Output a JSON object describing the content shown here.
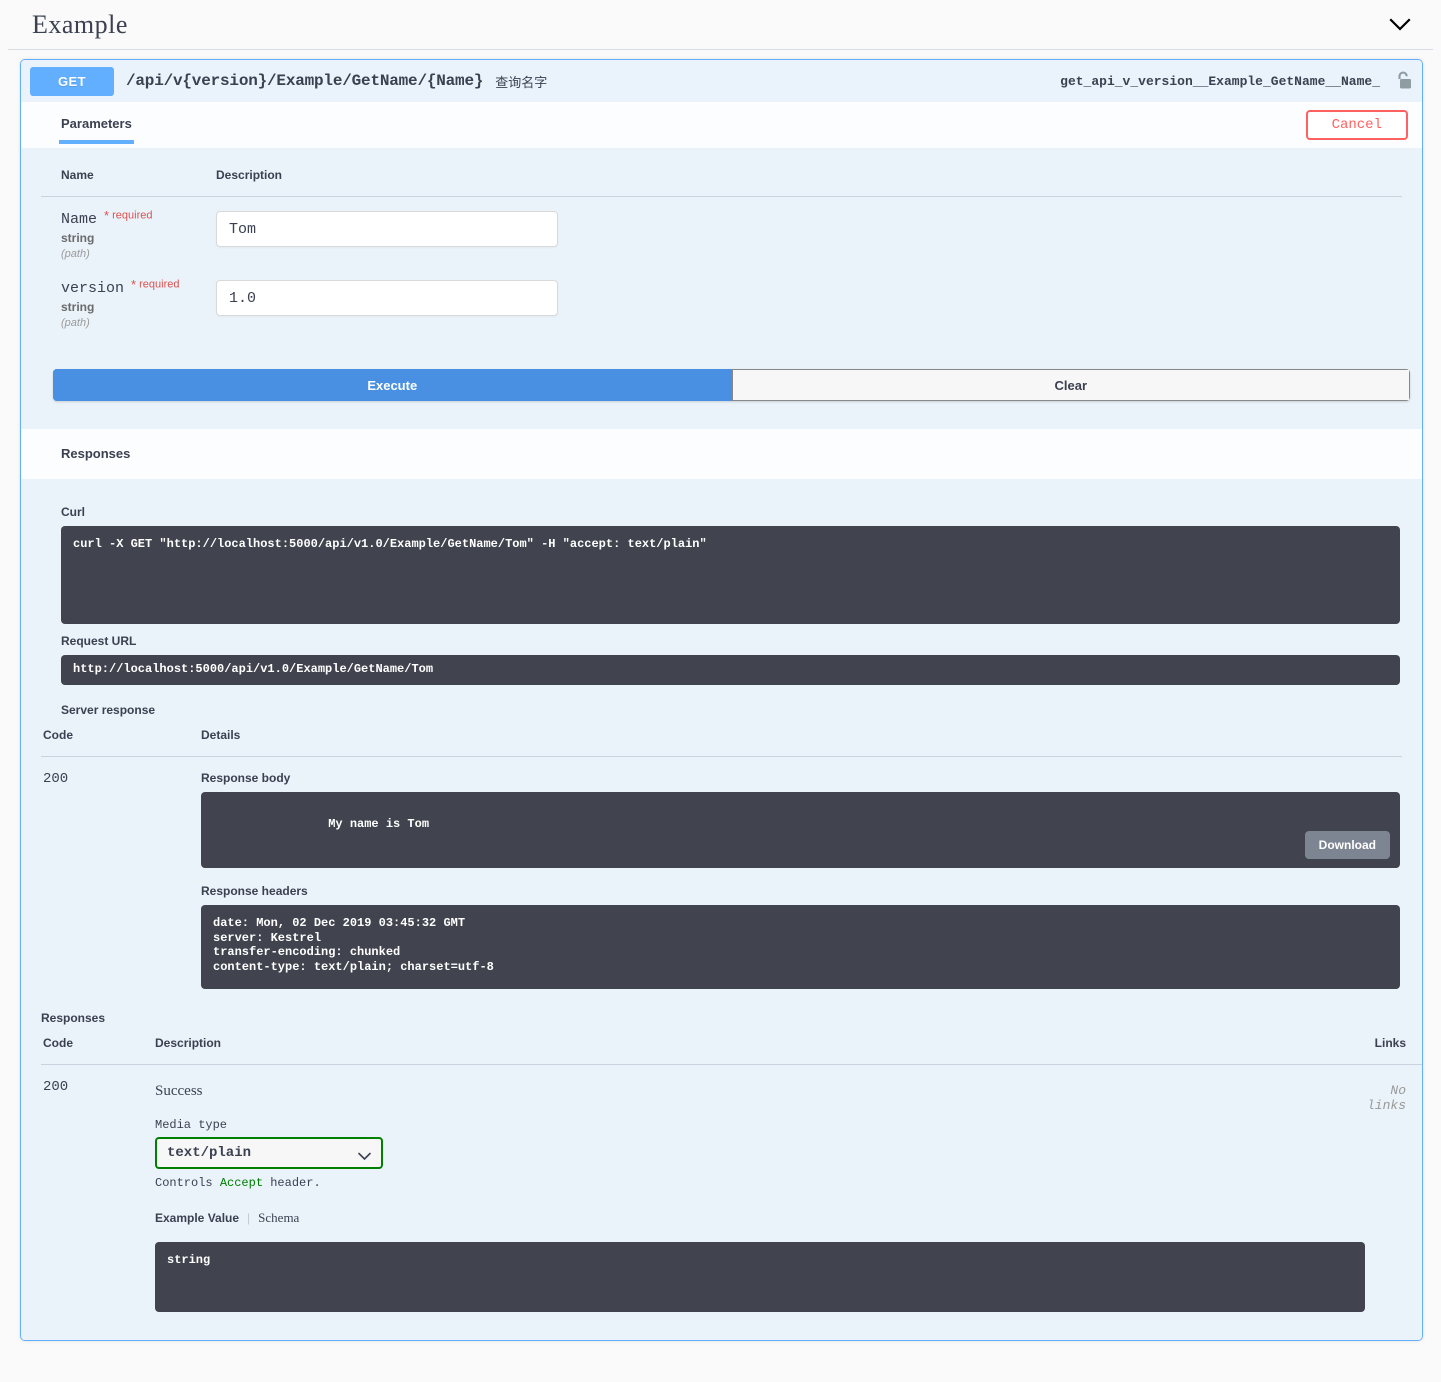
{
  "tag": {
    "title": "Example",
    "collapse_icon": "chevron-down-icon"
  },
  "operation": {
    "method": "GET",
    "path": "/api/v{version}/Example/GetName/{Name}",
    "description": "查询名字",
    "operation_id": "get_api_v_version__Example_GetName__Name_",
    "auth_icon": "unlocked-padlock-icon"
  },
  "tabs": {
    "parameters_label": "Parameters",
    "cancel_label": "Cancel"
  },
  "parameters": {
    "headers": {
      "name": "Name",
      "description": "Description"
    },
    "rows": [
      {
        "name": "Name",
        "required": "required",
        "type": "string",
        "in": "(path)",
        "value": "Tom"
      },
      {
        "name": "version",
        "required": "required",
        "type": "string",
        "in": "(path)",
        "value": "1.0"
      }
    ]
  },
  "actions": {
    "execute": "Execute",
    "clear": "Clear"
  },
  "responses_heading": "Responses",
  "live_response": {
    "curl_label": "Curl",
    "curl": "curl -X GET \"http://localhost:5000/api/v1.0/Example/GetName/Tom\" -H \"accept: text/plain\"",
    "request_url_label": "Request URL",
    "request_url": "http://localhost:5000/api/v1.0/Example/GetName/Tom",
    "server_response_label": "Server response",
    "headers": {
      "code": "Code",
      "details": "Details"
    },
    "code": "200",
    "response_body_label": "Response body",
    "response_body": "My name is Tom",
    "download_label": "Download",
    "response_headers_label": "Response headers",
    "response_headers": "date: Mon, 02 Dec 2019 03:45:32 GMT \nserver: Kestrel \ntransfer-encoding: chunked \ncontent-type: text/plain; charset=utf-8"
  },
  "documented_responses": {
    "title": "Responses",
    "headers": {
      "code": "Code",
      "description": "Description",
      "links": "Links"
    },
    "rows": [
      {
        "code": "200",
        "description": "Success",
        "links": "No links",
        "media_type_label": "Media type",
        "media_type_value": "text/plain",
        "media_type_options": [
          "text/plain"
        ],
        "controls_prefix": "Controls ",
        "controls_accept_word": "Accept",
        "controls_suffix": " header.",
        "example_value_tab": "Example Value",
        "schema_tab": "Schema",
        "example_value": "string"
      }
    ]
  },
  "colors": {
    "method_get": "#61affe",
    "panel_border": "#61affe",
    "execute": "#4990e2",
    "cancel": "#ff6060",
    "required": "#d9534f",
    "code_bg": "#41444e",
    "media_border": "#008000",
    "params_bg": "#eaf2fa"
  }
}
